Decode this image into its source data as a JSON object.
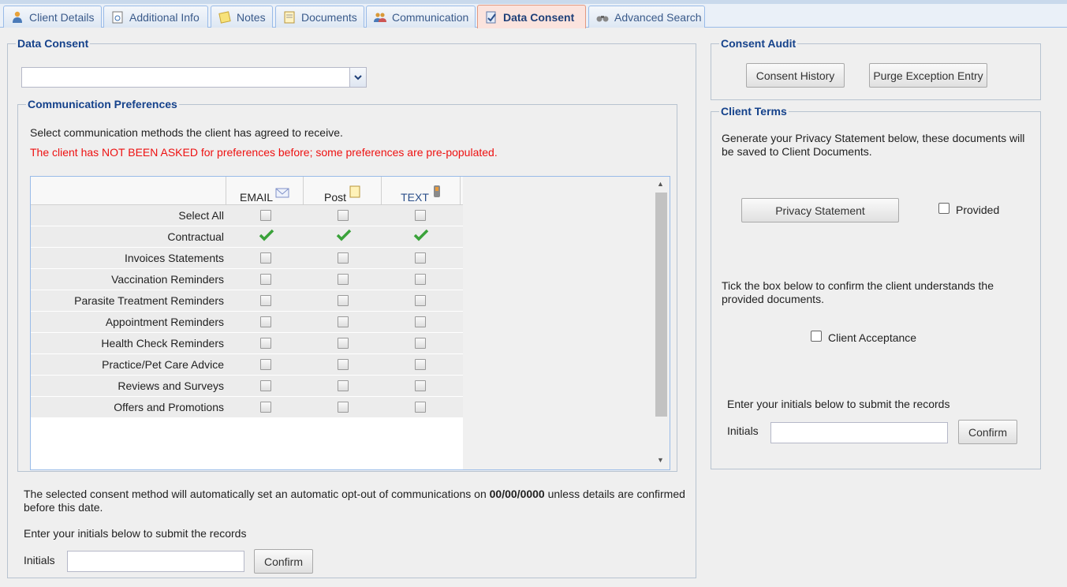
{
  "tabs": [
    {
      "label": "Client Details",
      "icon": "person-icon"
    },
    {
      "label": "Additional Info",
      "icon": "info-doc-icon"
    },
    {
      "label": "Notes",
      "icon": "notes-icon"
    },
    {
      "label": "Documents",
      "icon": "documents-icon"
    },
    {
      "label": "Communication",
      "icon": "people-icon"
    },
    {
      "label": "Data Consent",
      "icon": "consent-icon",
      "active": true
    },
    {
      "label": "Advanced Search",
      "icon": "binoculars-icon"
    }
  ],
  "data_consent": {
    "legend": "Data Consent",
    "select_value": "",
    "comm_prefs": {
      "legend": "Communication Preferences",
      "intro": "Select communication methods the client has agreed to receive.",
      "warning": "The client has NOT BEEN ASKED for preferences before; some preferences are pre-populated.",
      "columns": [
        "EMAIL",
        "Post",
        "TEXT"
      ],
      "rows": [
        {
          "label": "Select All",
          "email": false,
          "post": false,
          "text": false
        },
        {
          "label": "Contractual",
          "email": true,
          "post": true,
          "text": true
        },
        {
          "label": "Invoices Statements",
          "email": false,
          "post": false,
          "text": false
        },
        {
          "label": "Vaccination Reminders",
          "email": false,
          "post": false,
          "text": false
        },
        {
          "label": "Parasite Treatment Reminders",
          "email": false,
          "post": false,
          "text": false
        },
        {
          "label": "Appointment Reminders",
          "email": false,
          "post": false,
          "text": false
        },
        {
          "label": "Health Check Reminders",
          "email": false,
          "post": false,
          "text": false
        },
        {
          "label": "Practice/Pet Care Advice",
          "email": false,
          "post": false,
          "text": false
        },
        {
          "label": "Reviews and Surveys",
          "email": false,
          "post": false,
          "text": false
        },
        {
          "label": "Offers and Promotions",
          "email": false,
          "post": false,
          "text": false
        }
      ]
    },
    "optout_before": "The selected consent method will automatically set an automatic opt-out of communications on ",
    "optout_date": "00/00/0000",
    "optout_after": " unless details are confirmed before this date.",
    "initials_prompt": "Enter your initials below to submit the records",
    "initials_label": "Initials",
    "initials_value": "",
    "confirm_label": "Confirm"
  },
  "consent_audit": {
    "legend": "Consent Audit",
    "history_label": "Consent History",
    "purge_label": "Purge Exception Entry"
  },
  "client_terms": {
    "legend": "Client Terms",
    "generate_text": "Generate your Privacy Statement below, these documents will be saved to Client Documents.",
    "privacy_label": "Privacy Statement",
    "provided_label": "Provided",
    "provided_checked": false,
    "tick_text": "Tick the box below to confirm the client understands the provided documents.",
    "acceptance_label": "Client Acceptance",
    "acceptance_checked": false,
    "initials_prompt": "Enter your initials below to submit the records",
    "initials_label": "Initials",
    "initials_value": "",
    "confirm_label": "Confirm"
  },
  "colors": {
    "warning": "#ee1111",
    "legend": "#15428b",
    "check": "#3aa23a",
    "active_tab": "#fbe3dd"
  }
}
